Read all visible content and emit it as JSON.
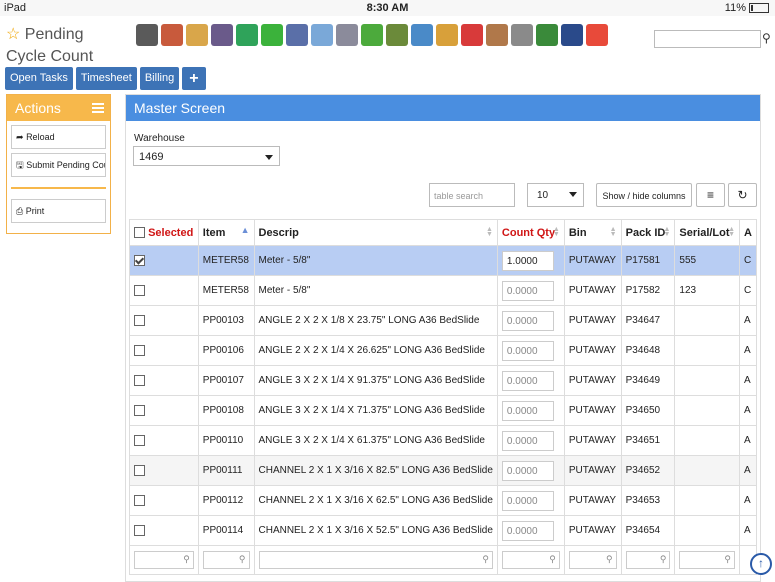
{
  "status_bar": {
    "device": "iPad",
    "time": "8:30 AM",
    "battery": "11%"
  },
  "title": "Pending Cycle Count",
  "toolbar_icons": [
    {
      "name": "bank-icon",
      "color": "#5a5a5a"
    },
    {
      "name": "user-icon",
      "color": "#c85a3c"
    },
    {
      "name": "landscape-icon",
      "color": "#d9a64a"
    },
    {
      "name": "calendar-16-icon",
      "color": "#6a5a8a"
    },
    {
      "name": "clock-icon",
      "color": "#2fa35a"
    },
    {
      "name": "checkmark-icon",
      "color": "#3bb23b"
    },
    {
      "name": "ledger-icon",
      "color": "#5a6fa8"
    },
    {
      "name": "magnifier-icon",
      "color": "#7aa8d8"
    },
    {
      "name": "truck-icon",
      "color": "#8b8b9b"
    },
    {
      "name": "basket-icon",
      "color": "#4caa3c"
    },
    {
      "name": "box-down-icon",
      "color": "#6b8a3a"
    },
    {
      "name": "box-up-icon",
      "color": "#4a8ac8"
    },
    {
      "name": "coins-icon",
      "color": "#d8a03a"
    },
    {
      "name": "chat-dollar-icon",
      "color": "#d83a3a"
    },
    {
      "name": "notes-icon",
      "color": "#b0784a"
    },
    {
      "name": "pencil-paper-icon",
      "color": "#8a8a8a"
    },
    {
      "name": "money-icon",
      "color": "#3a8a3a"
    },
    {
      "name": "safe-icon",
      "color": "#2a4a8a"
    },
    {
      "name": "puzzle-icon",
      "color": "#e84a3a"
    }
  ],
  "nav": {
    "open_tasks": "Open Tasks",
    "timesheet": "Timesheet",
    "billing": "Billing",
    "plus": "+"
  },
  "actions": {
    "title": "Actions",
    "reload": "Reload",
    "submit": "Submit Pending Count",
    "print": "Print"
  },
  "master": {
    "title": "Master Screen",
    "warehouse_label": "Warehouse",
    "warehouse_value": "1469",
    "table_search_placeholder": "table search",
    "page_size": "10",
    "show_hide_label": "Show / hide columns"
  },
  "table": {
    "headers": {
      "selected": "Selected",
      "item": "Item",
      "descrip": "Descrip",
      "count_qty": "Count Qty",
      "bin": "Bin",
      "pack_id": "Pack ID",
      "serial_lot": "Serial/Lot",
      "extra": "A"
    },
    "rows": [
      {
        "checked": true,
        "item": "METER58",
        "descrip": "Meter - 5/8\"",
        "qty": "1.0000",
        "bin": "PUTAWAY",
        "pack": "P17581",
        "serial": "555",
        "extra": "C"
      },
      {
        "checked": false,
        "item": "METER58",
        "descrip": "Meter - 5/8\"",
        "qty": "0.0000",
        "bin": "PUTAWAY",
        "pack": "P17582",
        "serial": "123",
        "extra": "C"
      },
      {
        "checked": false,
        "item": "PP00103",
        "descrip": "ANGLE 2 X 2 X 1/8 X 23.75\" LONG A36 BedSlide",
        "qty": "0.0000",
        "bin": "PUTAWAY",
        "pack": "P34647",
        "serial": "",
        "extra": "A"
      },
      {
        "checked": false,
        "item": "PP00106",
        "descrip": "ANGLE 2 X 2 X 1/4 X 26.625\" LONG A36 BedSlide",
        "qty": "0.0000",
        "bin": "PUTAWAY",
        "pack": "P34648",
        "serial": "",
        "extra": "A"
      },
      {
        "checked": false,
        "item": "PP00107",
        "descrip": "ANGLE 3 X 2 X 1/4 X 91.375\" LONG A36 BedSlide",
        "qty": "0.0000",
        "bin": "PUTAWAY",
        "pack": "P34649",
        "serial": "",
        "extra": "A"
      },
      {
        "checked": false,
        "item": "PP00108",
        "descrip": "ANGLE 3 X 2 X 1/4 X 71.375\" LONG A36 BedSlide",
        "qty": "0.0000",
        "bin": "PUTAWAY",
        "pack": "P34650",
        "serial": "",
        "extra": "A"
      },
      {
        "checked": false,
        "item": "PP00110",
        "descrip": "ANGLE 3 X 2 X 1/4 X 61.375\" LONG A36 BedSlide",
        "qty": "0.0000",
        "bin": "PUTAWAY",
        "pack": "P34651",
        "serial": "",
        "extra": "A"
      },
      {
        "checked": false,
        "item": "PP00111",
        "descrip": "CHANNEL 2 X 1 X 3/16 X 82.5\" LONG A36 BedSlide",
        "qty": "0.0000",
        "bin": "PUTAWAY",
        "pack": "P34652",
        "serial": "",
        "extra": "A"
      },
      {
        "checked": false,
        "item": "PP00112",
        "descrip": "CHANNEL 2 X 1 X 3/16 X 62.5\" LONG A36 BedSlide",
        "qty": "0.0000",
        "bin": "PUTAWAY",
        "pack": "P34653",
        "serial": "",
        "extra": "A"
      },
      {
        "checked": false,
        "item": "PP00114",
        "descrip": "CHANNEL 2 X 1 X 3/16 X 52.5\" LONG A36 BedSlide",
        "qty": "0.0000",
        "bin": "PUTAWAY",
        "pack": "P34654",
        "serial": "",
        "extra": "A"
      }
    ]
  }
}
